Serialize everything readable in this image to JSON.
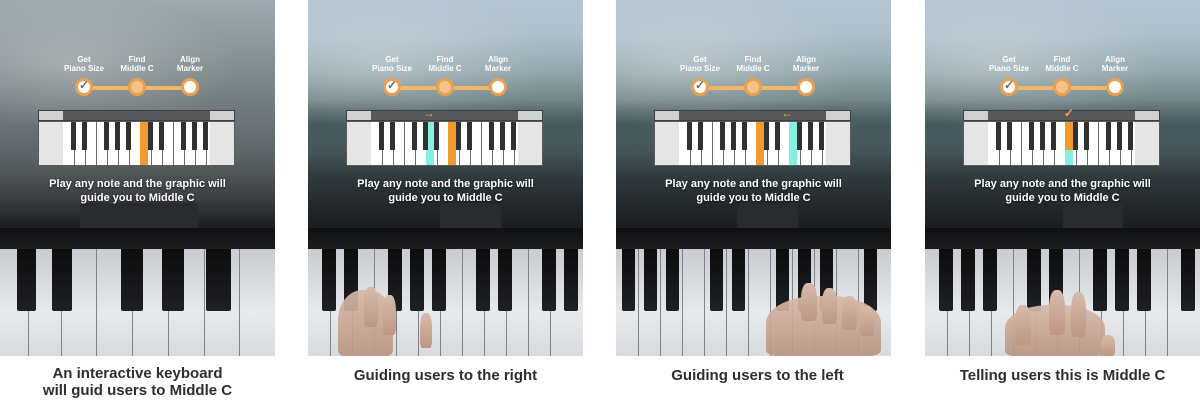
{
  "steps": [
    {
      "label_line1": "Get",
      "label_line2": "Piano Size"
    },
    {
      "label_line1": "Find",
      "label_line2": "Middle C"
    },
    {
      "label_line1": "Align",
      "label_line2": "Marker"
    }
  ],
  "instruction_line1": "Play any note and the graphic will",
  "instruction_line2": "guide you to Middle C",
  "panels": [
    {
      "caption_line1": "An interactive keyboard",
      "caption_line2": "will guid users to Middle C",
      "indicator": ""
    },
    {
      "caption_line1": "Guiding users to the right",
      "caption_line2": "",
      "indicator": "→"
    },
    {
      "caption_line1": "Guiding users to the left",
      "caption_line2": "",
      "indicator": "←"
    },
    {
      "caption_line1": "Telling users this is Middle C",
      "caption_line2": "",
      "indicator": "✓"
    }
  ],
  "colors": {
    "accent": "#f39a2e",
    "highlight": "#86f0e0",
    "step_fill": "#f4c38a"
  },
  "icons": {
    "done_step": "check-icon",
    "right": "arrow-right-icon",
    "left": "arrow-left-icon",
    "confirm": "check-icon"
  }
}
